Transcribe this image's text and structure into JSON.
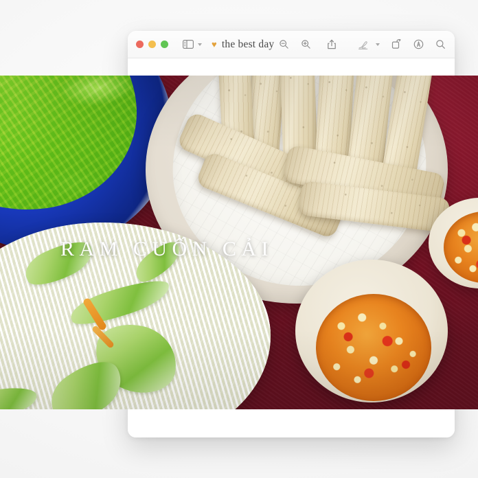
{
  "window": {
    "traffic_lights": [
      {
        "name": "close",
        "color": "#ec6a5e"
      },
      {
        "name": "minimize",
        "color": "#f4bf4f"
      },
      {
        "name": "zoom",
        "color": "#61c554"
      }
    ],
    "sidebar_toggle": {
      "icon": "sidebar-icon",
      "has_chevron": true
    },
    "title": "the best day",
    "title_emoji": "♥",
    "title_emoji_color": "#e3a23c",
    "toolbar_left": [
      {
        "name": "zoom-out-button",
        "icon": "magnifier-minus-icon"
      },
      {
        "name": "zoom-in-button",
        "icon": "magnifier-plus-icon"
      },
      {
        "name": "share-button",
        "icon": "share-icon"
      }
    ],
    "toolbar_right": [
      {
        "name": "markup-button",
        "icon": "pen-icon"
      },
      {
        "name": "markup-options",
        "icon": "chevron-down-icon"
      },
      {
        "name": "rotate-button",
        "icon": "rotate-icon"
      },
      {
        "name": "annotate-button",
        "icon": "annotate-circle-icon"
      },
      {
        "name": "search-button",
        "icon": "search-icon"
      }
    ]
  },
  "photo": {
    "caption": "RAM CUỐN CẢI",
    "alt_subjects": [
      "green lettuce in blue-rimmed bowl",
      "fried spring rolls on parchment paper",
      "shredded radish and cucumber salad",
      "chili garlic dipping sauce bowls"
    ],
    "background_color": "#7d1326",
    "caption_color": "#ffffff"
  },
  "page": {
    "background_color": "#f6f6f6",
    "window_background": "#ffffff"
  }
}
